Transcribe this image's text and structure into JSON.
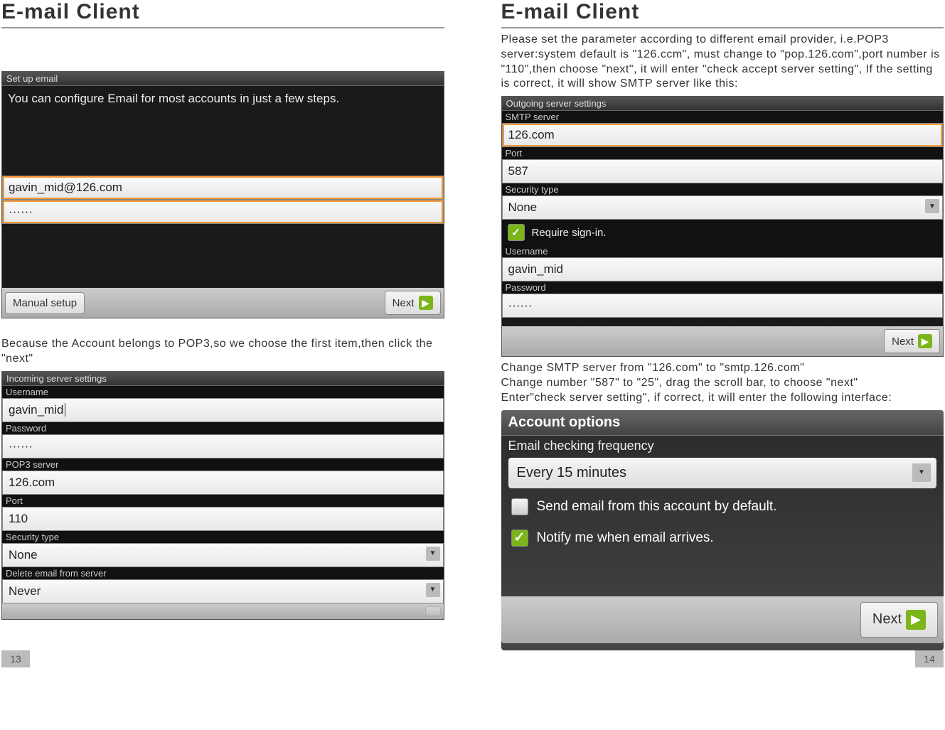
{
  "left": {
    "title": "E-mail Client",
    "pageNum": "13",
    "setup": {
      "title": "Set up email",
      "info": "You can configure Email for most accounts in just a few steps.",
      "email": "gavin_mid@126.com",
      "password": "······",
      "manualBtn": "Manual setup",
      "nextBtn": "Next"
    },
    "desc1": "Because the Account belongs to POP3,so we choose the first item,then click the \"next\"",
    "incoming": {
      "title": "Incoming server settings",
      "usernameLabel": "Username",
      "username": "gavin_mid",
      "passwordLabel": "Password",
      "password": "······",
      "pop3Label": "POP3 server",
      "pop3": "126.com",
      "portLabel": "Port",
      "port": "110",
      "securityLabel": "Security type",
      "security": "None",
      "deleteLabel": "Delete email from server",
      "delete": "Never"
    }
  },
  "right": {
    "title": "E-mail Client",
    "pageNum": "14",
    "desc1": "Please set the parameter according to different email provider, i.e.POP3 server:system default is \"126.ccm\", must change to \"pop.126.com\",port number is \"110\",then choose \"next\", it will enter \"check accept server setting\", If the setting is correct, it will show SMTP server like this:",
    "outgoing": {
      "title": "Outgoing server settings",
      "smtpLabel": "SMTP server",
      "smtp": "126.com",
      "portLabel": "Port",
      "port": "587",
      "securityLabel": "Security type",
      "security": "None",
      "requireSignin": "Require sign-in.",
      "usernameLabel": "Username",
      "username": "gavin_mid",
      "passwordLabel": "Password",
      "password": "······",
      "nextBtn": "Next"
    },
    "desc2": "Change SMTP server from \"126.com\" to \"smtp.126.com\"\nChange number \"587\" to \"25\", drag the scroll bar, to choose \"next\"\nEnter\"check server setting\", if correct, it will enter the following interface:",
    "options": {
      "title": "Account options",
      "freqLabel": "Email checking frequency",
      "freq": "Every 15 minutes",
      "defaultSend": "Send email from this account by default.",
      "notify": "Notify me when email arrives.",
      "nextBtn": "Next"
    }
  }
}
